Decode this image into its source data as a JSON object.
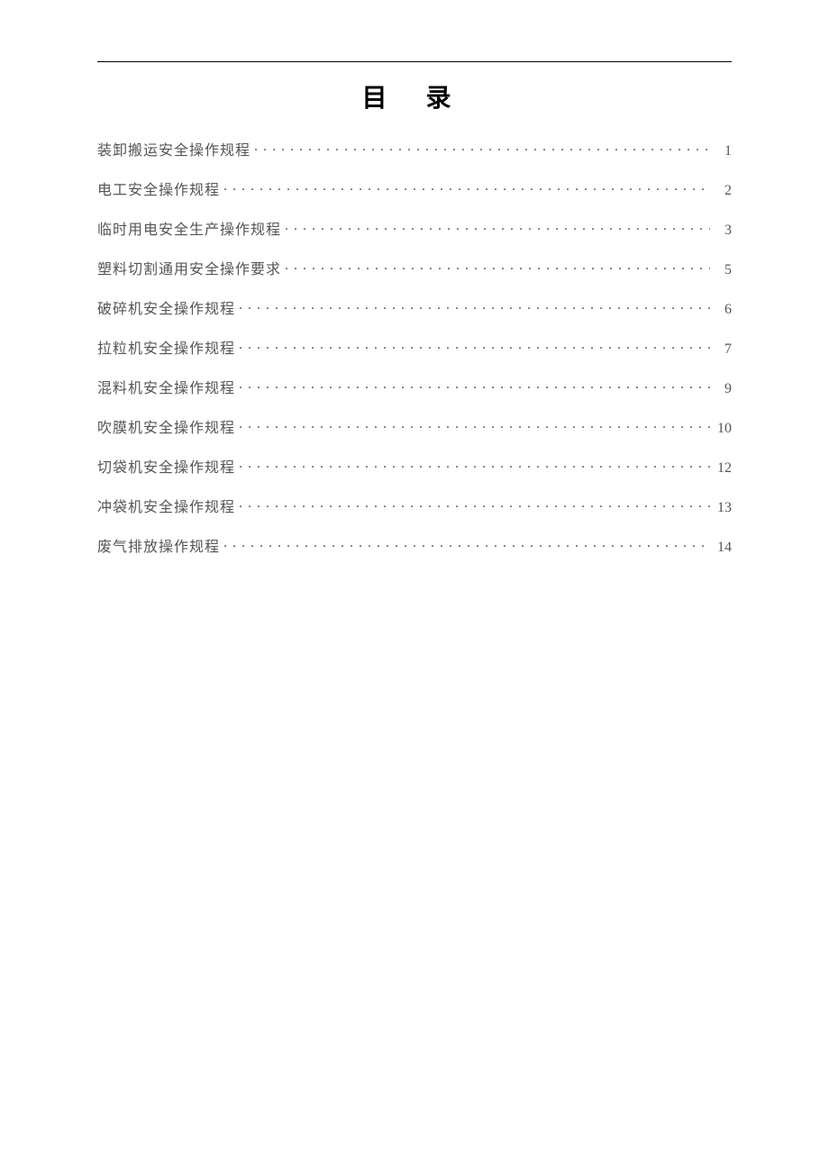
{
  "title": "目 录",
  "toc": [
    {
      "label": "装卸搬运安全操作规程",
      "page": "1"
    },
    {
      "label": "电工安全操作规程",
      "page": "2"
    },
    {
      "label": "临时用电安全生产操作规程",
      "page": "3"
    },
    {
      "label": "塑料切割通用安全操作要求",
      "page": "5"
    },
    {
      "label": "破碎机安全操作规程",
      "page": "6"
    },
    {
      "label": "拉粒机安全操作规程",
      "page": "7"
    },
    {
      "label": "混料机安全操作规程",
      "page": "9"
    },
    {
      "label": "吹膜机安全操作规程",
      "page": "10"
    },
    {
      "label": "切袋机安全操作规程",
      "page": "12"
    },
    {
      "label": "冲袋机安全操作规程",
      "page": "13"
    },
    {
      "label": "废气排放操作规程",
      "page": "14"
    }
  ]
}
